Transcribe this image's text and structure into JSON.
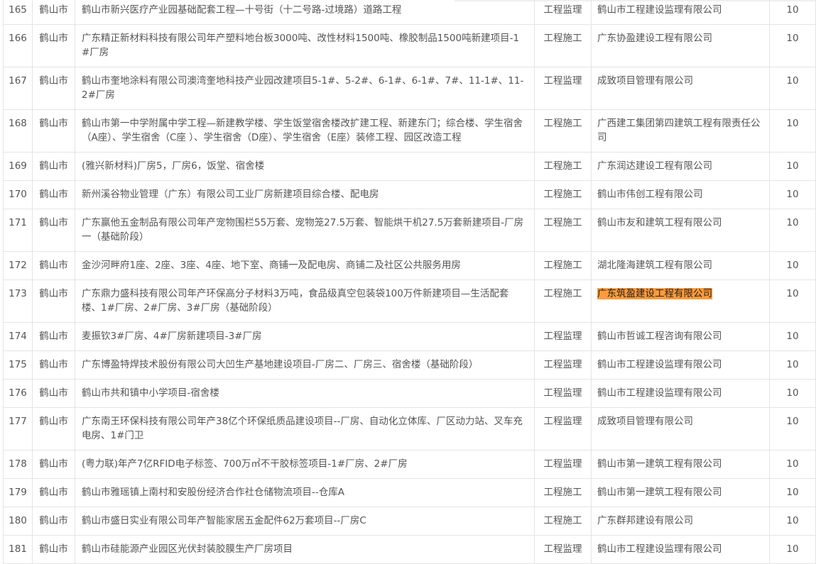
{
  "table": {
    "rows": [
      {
        "no": "165",
        "city": "鹤山市",
        "name": "鹤山市新兴医疗产业园基础配套工程—十号街（十二号路-过境路）道路工程",
        "type": "工程监理",
        "company": "鹤山市工程建设监理有限公司",
        "score": "10"
      },
      {
        "no": "166",
        "city": "鹤山市",
        "name": "广东精正新材料科技有限公司年产塑料地台板3000吨、改性材料1500吨、橡胶制品1500吨新建项目-1#厂房",
        "type": "工程施工",
        "company": "广东协盈建设工程有限公司",
        "score": "10"
      },
      {
        "no": "167",
        "city": "鹤山市",
        "name": "鹤山市奎地涂料有限公司澳湾奎地科技产业园改建项目5-1#、5-2#、6-1#、6-1#、7#、11-1#、11-2#厂房",
        "type": "工程监理",
        "company": "成致项目管理有限公司",
        "score": "10"
      },
      {
        "no": "168",
        "city": "鹤山市",
        "name": "鹤山市第一中学附属中学工程—新建教学楼、学生饭堂宿舍楼改扩建工程、新建东门；综合楼、学生宿舍（A座）、学生宿舍（C座 ）、学生宿舍（D座）、学生宿舍（E座）装修工程、园区改造工程",
        "type": "工程施工",
        "company": "广西建工集团第四建筑工程有限责任公司",
        "score": "10"
      },
      {
        "no": "169",
        "city": "鹤山市",
        "name": "(雅兴新材料)厂房5，厂房6，饭堂、宿舍楼",
        "type": "工程施工",
        "company": "广东润达建设工程有限公司",
        "score": "10"
      },
      {
        "no": "170",
        "city": "鹤山市",
        "name": "新州溪谷物业管理（广东）有限公司工业厂房新建项目综合楼、配电房",
        "type": "工程施工",
        "company": "鹤山市伟创工程有限公司",
        "score": "10"
      },
      {
        "no": "171",
        "city": "鹤山市",
        "name": "广东赢他五金制品有限公司年产宠物围栏55万套、宠物笼27.5万套、智能烘干机27.5万套新建项目-厂房一（基础阶段）",
        "type": "工程施工",
        "company": "鹤山市友和建筑工程有限公司",
        "score": "10"
      },
      {
        "no": "172",
        "city": "鹤山市",
        "name": "金沙河畔府1座、2座、3座、4座、地下室、商铺一及配电房、商铺二及社区公共服务用房",
        "type": "工程施工",
        "company": "湖北隆海建筑工程有限公司",
        "score": "10"
      },
      {
        "no": "173",
        "city": "鹤山市",
        "name": "广东鼎力盛科技有限公司年产环保高分子材料3万吨，食品级真空包装袋100万件新建项目—生活配套楼、1#厂房、2#厂房、3#厂房（基础阶段）",
        "type": "工程施工",
        "company": "广东筑盈建设工程有限公司",
        "score": "10",
        "highlight": true
      },
      {
        "no": "174",
        "city": "鹤山市",
        "name": "麦振钦3#厂房、4#厂房新建项目-3#厂房",
        "type": "工程监理",
        "company": "鹤山市哲诚工程咨询有限公司",
        "score": "10"
      },
      {
        "no": "175",
        "city": "鹤山市",
        "name": "广东博盈特焊技术股份有限公司大凹生产基地建设项目-厂房二、厂房三、宿舍楼（基础阶段）",
        "type": "工程监理",
        "company": "鹤山市工程建设监理有限公司",
        "score": "10"
      },
      {
        "no": "176",
        "city": "鹤山市",
        "name": "鹤山市共和镇中小学项目-宿舍楼",
        "type": "工程监理",
        "company": "鹤山市工程建设监理有限公司",
        "score": "10"
      },
      {
        "no": "177",
        "city": "鹤山市",
        "name": "广东南王环保科技有限公司年产38亿个环保纸质品建设项目--厂房、自动化立体库、厂区动力站、叉车充电房、1#门卫",
        "type": "工程监理",
        "company": "成致项目管理有限公司",
        "score": "10"
      },
      {
        "no": "178",
        "city": "鹤山市",
        "name": "(粤力联)年产7亿RFID电子标签、700万㎡不干胶标签项目-1#厂房、2#厂房",
        "type": "工程监理",
        "company": "鹤山市第一建筑工程有限公司",
        "score": "10"
      },
      {
        "no": "179",
        "city": "鹤山市",
        "name": "鹤山市雅瑶镇上南村和安股份经济合作社仓储物流项目--仓库A",
        "type": "工程施工",
        "company": "鹤山市第一建筑工程有限公司",
        "score": "10"
      },
      {
        "no": "180",
        "city": "鹤山市",
        "name": "鹤山市盛日实业有限公司年产智能家居五金配件62万套项目--厂房C",
        "type": "工程施工",
        "company": "广东群邦建设有限公司",
        "score": "10"
      },
      {
        "no": "181",
        "city": "鹤山市",
        "name": "鹤山市硅能源产业园区光伏封装胶膜生产厂房项目",
        "type": "工程监理",
        "company": "鹤山市工程建设监理有限公司",
        "score": "10"
      }
    ]
  }
}
